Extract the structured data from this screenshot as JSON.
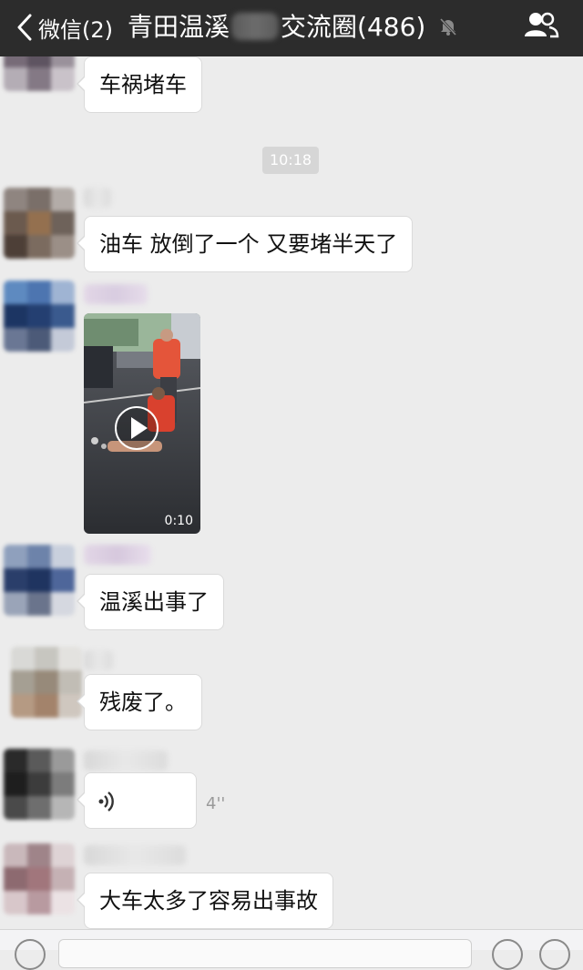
{
  "navbar": {
    "back_label": "微信(2)",
    "title_start": "青田温溪",
    "title_end": "交流圈(486)"
  },
  "messages": {
    "m1": "车祸堵车",
    "time": "10:18",
    "m2": "油车  放倒了一个   又要堵半天了",
    "video_duration": "0:10",
    "m4": "温溪出事了",
    "m5": "残废了。",
    "voice_duration": "4''",
    "m7": "大车太多了容易出事故"
  },
  "colors": {
    "navbar": "#2c2c2c",
    "chat_background": "#ececec",
    "bubble": "#ffffff"
  },
  "icons": [
    "back-chevron-icon",
    "mute-icon",
    "group-members-icon",
    "play-icon",
    "voice-wave-icon"
  ]
}
